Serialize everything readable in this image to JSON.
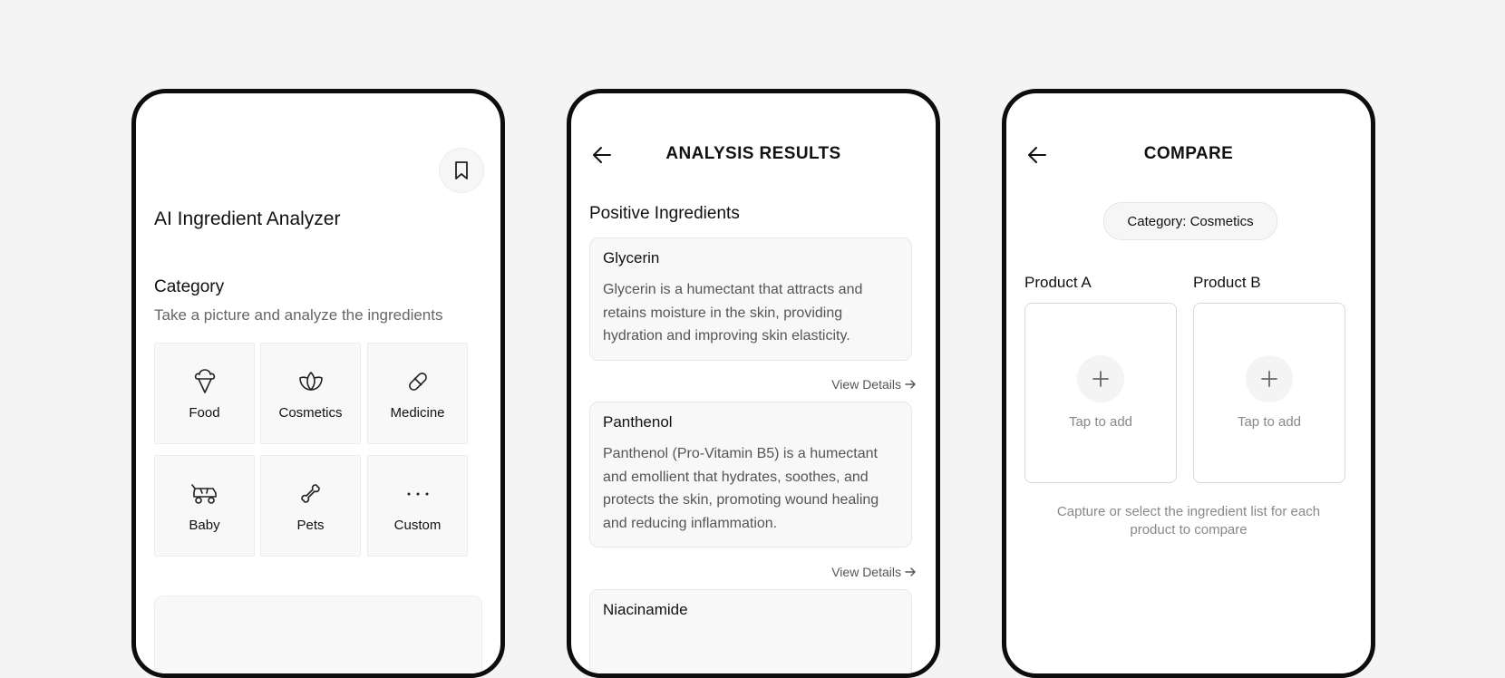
{
  "screen1": {
    "bookmark_icon": "bookmark-icon",
    "app_title": "AI Ingredient Analyzer",
    "category_title": "Category",
    "category_subtitle": "Take a picture and analyze the ingredients",
    "categories": [
      {
        "label": "Food",
        "icon": "ice-cream-icon"
      },
      {
        "label": "Cosmetics",
        "icon": "lotus-icon"
      },
      {
        "label": "Medicine",
        "icon": "pill-icon"
      },
      {
        "label": "Baby",
        "icon": "stroller-icon"
      },
      {
        "label": "Pets",
        "icon": "bone-icon"
      },
      {
        "label": "Custom",
        "icon": "ellipsis-icon"
      }
    ]
  },
  "screen2": {
    "back_icon": "arrow-left-icon",
    "header_title": "ANALYSIS RESULTS",
    "section_title": "Positive Ingredients",
    "ingredients": [
      {
        "name": "Glycerin",
        "description": "Glycerin is a humectant that attracts and retains moisture in the skin, providing hydration and improving skin elasticity.",
        "link": "View Details"
      },
      {
        "name": "Panthenol",
        "description": "Panthenol (Pro-Vitamin B5) is a humectant and emollient that hydrates, soothes, and protects the skin, promoting wound healing and reducing inflammation.",
        "link": "View Details"
      },
      {
        "name": "Niacinamide"
      }
    ]
  },
  "screen3": {
    "back_icon": "arrow-left-icon",
    "header_title": "COMPARE",
    "category_chip": "Category: Cosmetics",
    "products": [
      {
        "label": "Product A",
        "action": "Tap to add"
      },
      {
        "label": "Product B",
        "action": "Tap to add"
      }
    ],
    "helper_text": "Capture or select the ingredient list for each product to compare"
  }
}
